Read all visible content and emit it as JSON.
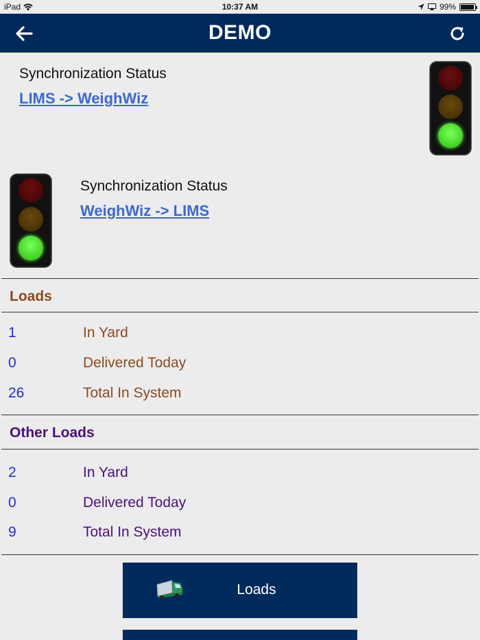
{
  "status_bar": {
    "device": "iPad",
    "time": "10:37 AM",
    "battery": "99%"
  },
  "header": {
    "title": "DEMO",
    "back_icon": "arrow-left-icon",
    "refresh_icon": "refresh-icon",
    "accent_color": "#002a5c"
  },
  "sync": [
    {
      "label": "Synchronization Status",
      "link": "LIMS -> WeighWiz",
      "light": "green"
    },
    {
      "label": "Synchronization Status",
      "link": "WeighWiz -> LIMS",
      "light": "green"
    }
  ],
  "loads": {
    "title": "Loads",
    "rows": [
      {
        "count": "1",
        "label": "In Yard"
      },
      {
        "count": "0",
        "label": "Delivered Today"
      },
      {
        "count": "26",
        "label": "Total In System"
      }
    ]
  },
  "other_loads": {
    "title": "Other Loads",
    "rows": [
      {
        "count": "2",
        "label": "In Yard"
      },
      {
        "count": "0",
        "label": "Delivered Today"
      },
      {
        "count": "9",
        "label": "Total In System"
      }
    ]
  },
  "buttons": {
    "loads_label": "Loads",
    "loads_icon": "truck-icon"
  }
}
